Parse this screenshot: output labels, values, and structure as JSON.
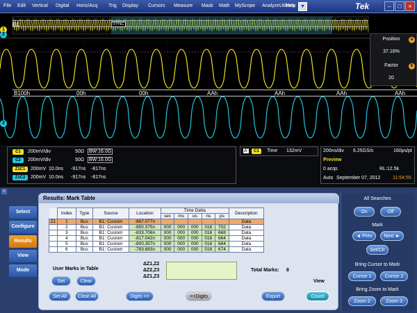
{
  "menu": {
    "items": [
      "File",
      "Edit",
      "Vertical",
      "Digital",
      "Horiz/Acq",
      "Trig",
      "Display",
      "Cursors",
      "Measure",
      "Mask",
      "Math",
      "MyScope",
      "Analyze",
      "Utilities",
      "Help"
    ],
    "brand": "Tek"
  },
  "scope": {
    "bus_label": "B1",
    "bus2_label": "B100h",
    "bus2_values": [
      "00h",
      "00h",
      "AAh",
      "AAh",
      "AAh",
      "AAh"
    ],
    "sync_label": "SYNC",
    "ch1_marker": "1",
    "ch2_marker": "2"
  },
  "zoom": {
    "position_label": "Position",
    "position_value": "37.16%",
    "factor_label": "Factor",
    "factor_value": "20",
    "a": "a",
    "b": "b"
  },
  "readout": {
    "channels": [
      {
        "chip": "C1",
        "scale": "200mV/div",
        "imp": "50Ω",
        "bw": "BW:16.0G"
      },
      {
        "chip": "C2",
        "scale": "200mV/div",
        "imp": "50Ω",
        "bw": "BW:16.0G"
      }
    ],
    "zooms": [
      {
        "chip": "Z1C1",
        "scale": "200mV",
        "t": "10.0ns",
        "a": "-917ns",
        "b": "-817ns"
      },
      {
        "chip": "Z1C2",
        "scale": "200mV",
        "t": "10.0ns",
        "a": "-917ns",
        "b": "-817ns"
      }
    ],
    "trigger": {
      "a": "A'",
      "chip": "C1",
      "label": "Time",
      "value": "132mV"
    },
    "horiz": {
      "tdiv": "200ns/div",
      "rate": "6.25GS/s",
      "pts": "160ps/pt",
      "mode": "Preview",
      "acqs": "0 acqs",
      "rl": "RL:12.5k",
      "trig": "Auto",
      "date": "September 07, 2012",
      "time": "11:54:55"
    }
  },
  "side_buttons": [
    "Select",
    "Configure",
    "Results",
    "View",
    "Mode"
  ],
  "results": {
    "title": "Results: Mark Table",
    "headers": [
      "Index",
      "Type",
      "Source",
      "Location",
      "Time Delta",
      "Description"
    ],
    "subheaders": [
      "sec",
      "ms",
      "us",
      "ns",
      "ps"
    ],
    "rows": [
      {
        "z": "Z1",
        "index": "1",
        "type": "Bus",
        "source": "B1: Custom",
        "location": "-867.077n",
        "td": [
          "",
          "",
          "",
          "",
          ""
        ],
        "desc": "Data"
      },
      {
        "z": "",
        "index": "2",
        "type": "Bus",
        "source": "B1: Custom",
        "location": "-850.375n",
        "td": [
          "000",
          "000",
          "000",
          "016",
          "702"
        ],
        "desc": "Data"
      },
      {
        "z": "",
        "index": "3",
        "type": "Bus",
        "source": "B1: Custom",
        "location": "-833.706n",
        "td": [
          "000",
          "000",
          "000",
          "016",
          "668"
        ],
        "desc": "Data"
      },
      {
        "z": "",
        "index": "4",
        "type": "Bus",
        "source": "B1: Custom",
        "location": "-817.042n",
        "td": [
          "000",
          "000",
          "000",
          "016",
          "664"
        ],
        "desc": "Data"
      },
      {
        "z": "",
        "index": "5",
        "type": "Bus",
        "source": "B1: Custom",
        "location": "-800.357n",
        "td": [
          "000",
          "000",
          "000",
          "016",
          "684"
        ],
        "desc": "Data"
      },
      {
        "z": "",
        "index": "6",
        "type": "Bus",
        "source": "B1: Custom",
        "location": "-783.683n",
        "td": [
          "000",
          "000",
          "000",
          "016",
          "674"
        ],
        "desc": "Data"
      }
    ],
    "delta_labels": [
      "ΔZ1,Z2",
      "ΔZ2,Z3",
      "ΔZ1,Z3"
    ],
    "user_marks_label": "User Marks in Table",
    "total_marks_label": "Total Marks:",
    "total_marks": "8",
    "view_label": "View",
    "buttons": {
      "set": "Set",
      "clear": "Clear",
      "set_all": "Set All",
      "clear_all": "Clear All",
      "digits_more": "Digits >>",
      "digits_less": "<<Digits",
      "export": "Export",
      "count": "Count"
    }
  },
  "right_panel": {
    "all_searches": "All Searches",
    "on": "On",
    "off": "Off",
    "mark": "Mark",
    "prev": "◄ Prev",
    "next": "Next ►",
    "set_clr": "Set/Clr",
    "bring_cursor": "Bring Cursor to Mark",
    "cursor1": "Cursor 1",
    "cursor2": "Cursor 2",
    "bring_zoom": "Bring Zoom to Mark",
    "zoom2": "Zoom 2",
    "zoom3": "Zoom 3"
  },
  "colors": {
    "ch1": "#f0e020",
    "ch2": "#20c8e0",
    "accent": "#f0a030",
    "selected_row": "#f0a868"
  }
}
